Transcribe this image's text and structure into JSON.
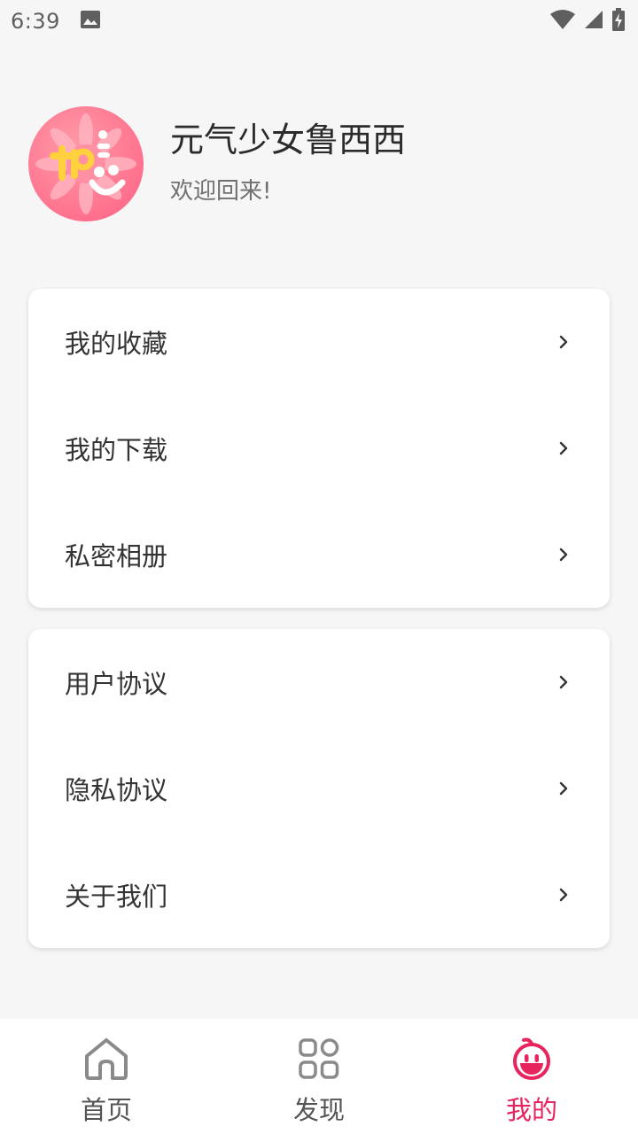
{
  "status_bar": {
    "time": "6:39",
    "icons": [
      "image-icon",
      "wifi-icon",
      "signal-icon",
      "battery-charging-icon"
    ]
  },
  "profile": {
    "name": "元气少女鲁西西",
    "welcome": "欢迎回来!",
    "avatar_icon": "avatar-flower-logo"
  },
  "menu_group_1": [
    {
      "label": "我的收藏"
    },
    {
      "label": "我的下载"
    },
    {
      "label": "私密相册"
    }
  ],
  "menu_group_2": [
    {
      "label": "用户协议"
    },
    {
      "label": "隐私协议"
    },
    {
      "label": "关于我们"
    }
  ],
  "bottom_nav": [
    {
      "label": "首页",
      "icon": "home-icon",
      "active": false
    },
    {
      "label": "发现",
      "icon": "grid-icon",
      "active": false
    },
    {
      "label": "我的",
      "icon": "face-icon",
      "active": true
    }
  ],
  "colors": {
    "accent": "#e8245f",
    "background": "#f6f6f6",
    "card": "#ffffff"
  }
}
